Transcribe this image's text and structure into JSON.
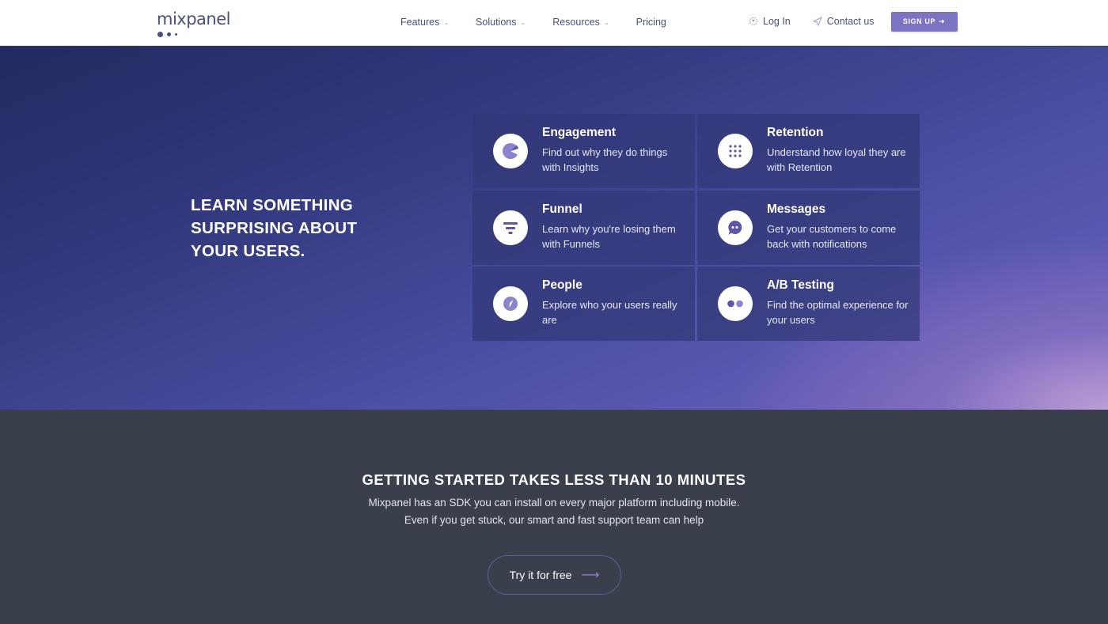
{
  "brand": {
    "name": "mixpanel",
    "accent": "#7b74c2",
    "navy": "#4a4f7e"
  },
  "nav": {
    "links": [
      {
        "label": "Features",
        "icon": "chevron-down-icon"
      },
      {
        "label": "Solutions",
        "icon": "chevron-down-icon"
      },
      {
        "label": "Resources",
        "icon": "chevron-down-icon"
      },
      {
        "label": "Pricing"
      }
    ],
    "login_label": "Log In",
    "contact_label": "Contact us",
    "signup_label": "SIGN UP"
  },
  "hero": {
    "heading": "LEARN SOMETHING SURPRISING ABOUT YOUR USERS.",
    "cards": [
      {
        "title": "Engagement",
        "desc": "Find out why they do things with Insights",
        "icon": "pie-chart-icon"
      },
      {
        "title": "Retention",
        "desc": "Understand how loyal they are with Retention",
        "icon": "dot-grid-icon"
      },
      {
        "title": "Funnel",
        "desc": "Learn why you're losing them with Funnels",
        "icon": "funnel-icon"
      },
      {
        "title": "Messages",
        "desc": "Get your customers to come back with notifications",
        "icon": "chat-bubble-icon"
      },
      {
        "title": "People",
        "desc": "Explore who your users really are",
        "icon": "compass-icon"
      },
      {
        "title": "A/B Testing",
        "desc": "Find the optimal experience for your users",
        "icon": "two-dots-icon"
      }
    ]
  },
  "getting_started": {
    "title": "GETTING STARTED TAKES LESS THAN 10 MINUTES",
    "line1": "Mixpanel has an SDK you can install on every major platform including mobile.",
    "line2": "Even if you get stuck, our smart and fast support team can help",
    "cta_label": "Try it for free"
  }
}
